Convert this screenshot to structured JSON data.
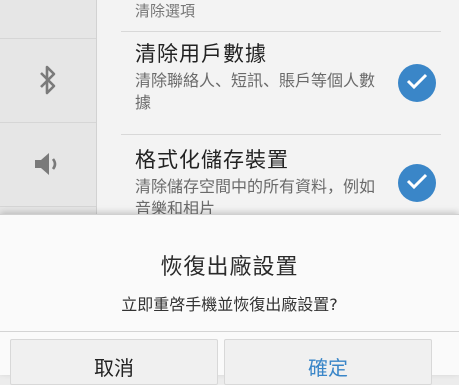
{
  "section": {
    "header": "清除選項"
  },
  "options": [
    {
      "title": "清除用戶數據",
      "description": "清除聯絡人、短訊、賬戶等個人數據",
      "checked": true
    },
    {
      "title": "格式化儲存裝置",
      "description": "清除儲存空間中的所有資料，例如音樂和相片",
      "checked": true
    }
  ],
  "rail_icons": [
    "bluetooth-icon",
    "volume-icon",
    "brightness-icon"
  ],
  "dialog": {
    "title": "恢復出廠設置",
    "message": "立即重啓手機並恢復出廠設置?",
    "cancel_label": "取消",
    "ok_label": "確定"
  },
  "colors": {
    "accent": "#3a86c8"
  }
}
